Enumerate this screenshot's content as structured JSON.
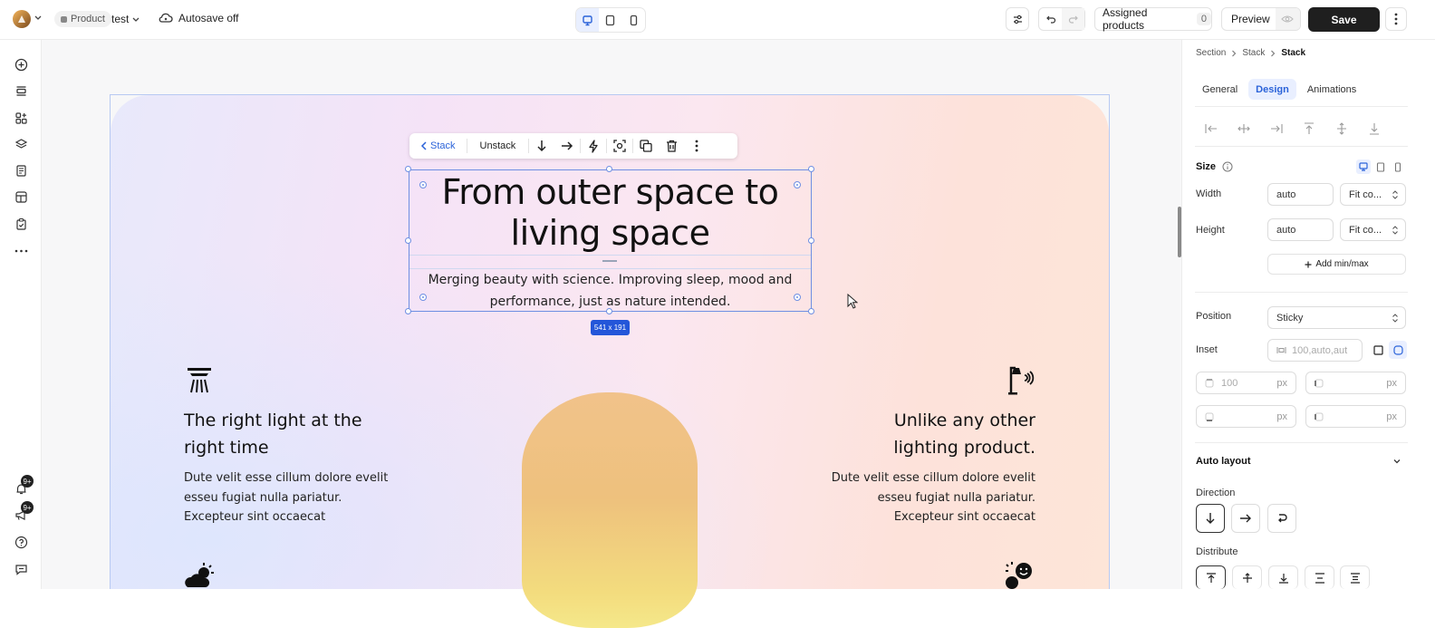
{
  "topbar": {
    "product_pill": "Product",
    "page_name": "test",
    "autosave": "Autosave off",
    "assigned_label": "Assigned products",
    "assigned_count": "0",
    "preview_label": "Preview",
    "save_label": "Save"
  },
  "floating_toolbar": {
    "back_label": "Stack",
    "unstack_label": "Unstack"
  },
  "canvas": {
    "headline": "From outer space to living space",
    "subheadline": "Merging beauty with science. Improving sleep, mood and performance, just as nature intended.",
    "dimension_badge": "541 x 191",
    "feature_left": {
      "title": "The right light at the right time",
      "body": "Dute velit esse cillum dolore evelit esseu fugiat nulla pariatur. Excepteur sint occaecat"
    },
    "feature_right": {
      "title": "Unlike any other lighting product.",
      "body": "Dute velit esse cillum dolore evelit esseu fugiat nulla pariatur. Excepteur sint occaecat"
    }
  },
  "left_sidebar": {
    "notifications_badge": "9+",
    "announcements_badge": "9+"
  },
  "panel": {
    "breadcrumb": [
      "Section",
      "Stack",
      "Stack"
    ],
    "tabs": [
      "General",
      "Design",
      "Animations"
    ],
    "size_label": "Size",
    "width_label": "Width",
    "width_value": "auto",
    "width_mode": "Fit co...",
    "height_label": "Height",
    "height_value": "auto",
    "height_mode": "Fit co...",
    "add_minmax": "Add min/max",
    "position_label": "Position",
    "position_value": "Sticky",
    "inset_label": "Inset",
    "inset_placeholder": "100,auto,aut",
    "inset_top": "100",
    "unit_px": "px",
    "auto_layout_label": "Auto layout",
    "direction_label": "Direction",
    "distribute_label": "Distribute"
  }
}
